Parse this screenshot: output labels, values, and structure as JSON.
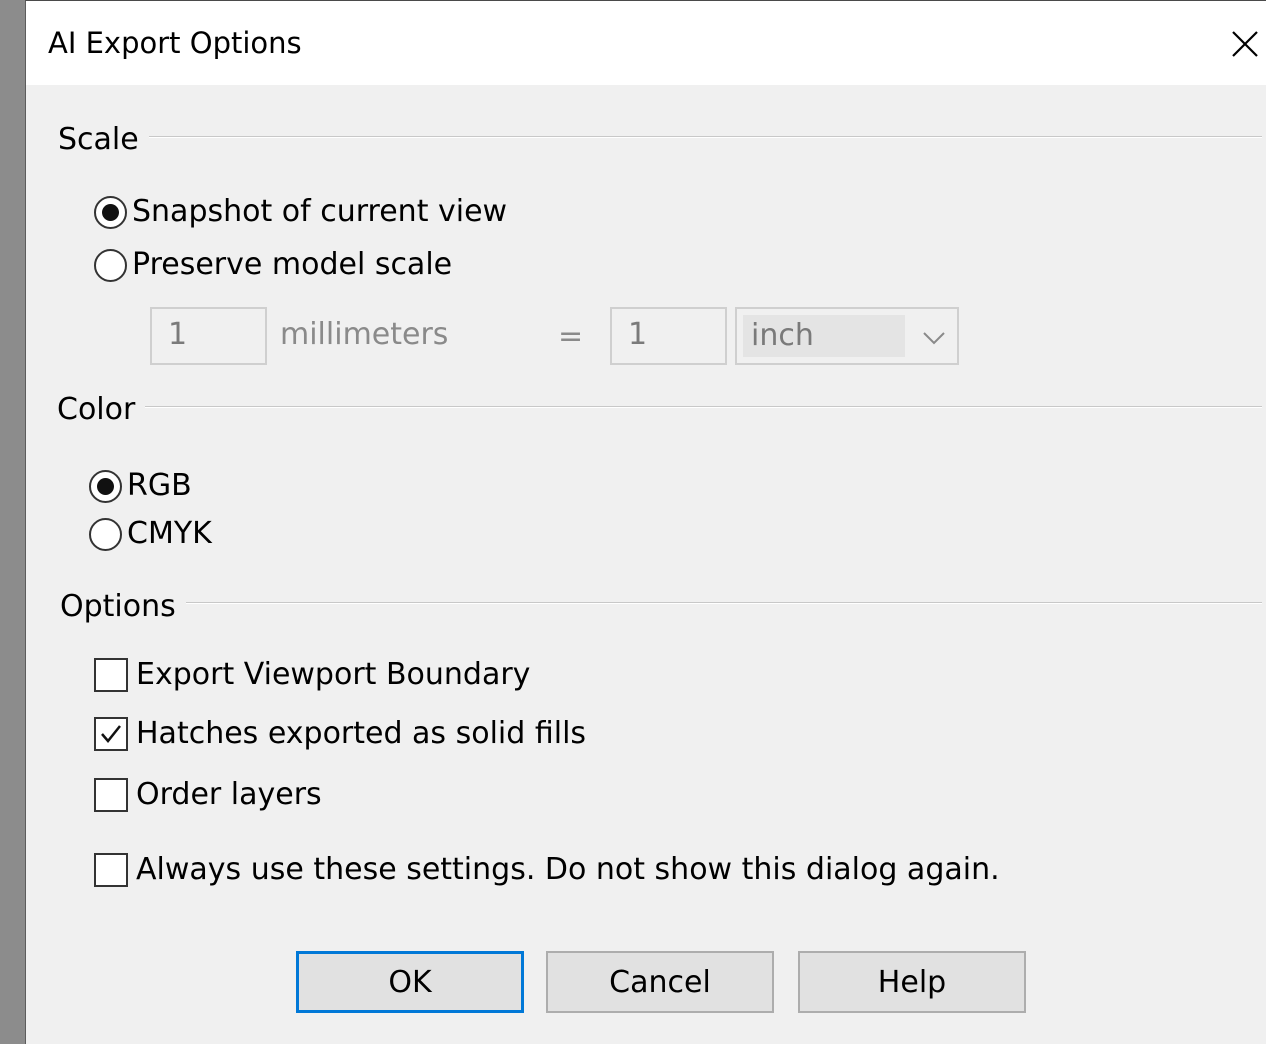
{
  "dialog": {
    "title": "AI Export Options",
    "close_icon": "close-icon"
  },
  "scale": {
    "label": "Scale",
    "options": [
      {
        "label": "Snapshot of current view",
        "selected": true
      },
      {
        "label": "Preserve model scale",
        "selected": false
      }
    ],
    "paper_value": "1",
    "paper_unit": "millimeters",
    "equals": "=",
    "model_value": "1",
    "model_unit": "inch"
  },
  "color": {
    "label": "Color",
    "options": [
      {
        "label": "RGB",
        "selected": true
      },
      {
        "label": "CMYK",
        "selected": false
      }
    ]
  },
  "options": {
    "label": "Options",
    "items": [
      {
        "label": "Export Viewport Boundary",
        "checked": false
      },
      {
        "label": "Hatches exported as solid fills",
        "checked": true
      },
      {
        "label": "Order layers",
        "checked": false
      }
    ],
    "always_use": {
      "label": "Always use these settings. Do not show this dialog again.",
      "checked": false
    }
  },
  "buttons": {
    "ok": "OK",
    "cancel": "Cancel",
    "help": "Help"
  },
  "colors": {
    "dialog_bg": "#f0f0f0",
    "accent": "#0078d7",
    "button_bg": "#e1e1e1"
  }
}
